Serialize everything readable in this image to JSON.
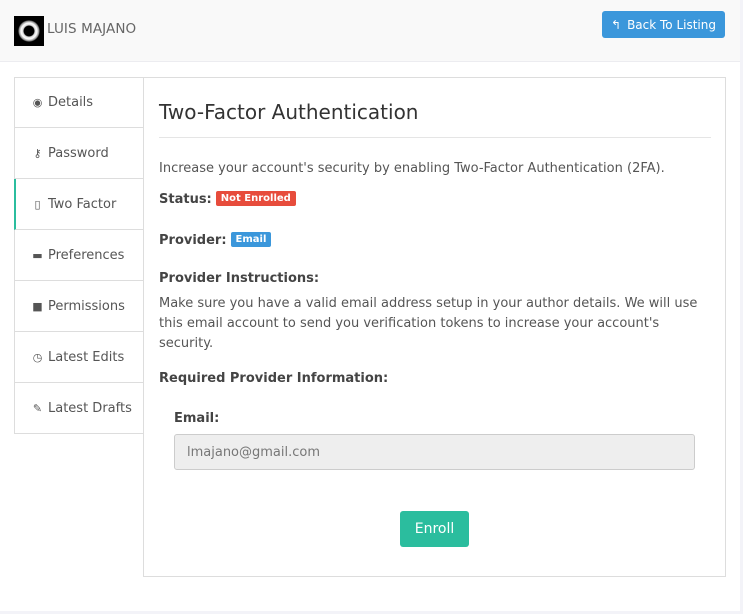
{
  "header": {
    "user_name": "LUIS MAJANO",
    "back_button": "Back To Listing"
  },
  "tabs": [
    {
      "label": "Details",
      "icon": "eye-icon",
      "glyph": "👁",
      "active": false
    },
    {
      "label": "Password",
      "icon": "key-icon",
      "glyph": "🔑",
      "active": false
    },
    {
      "label": "Two Factor",
      "icon": "mobile-icon",
      "glyph": "▯",
      "active": true
    },
    {
      "label": "Preferences",
      "icon": "briefcase-icon",
      "glyph": "💼",
      "active": false
    },
    {
      "label": "Permissions",
      "icon": "lock-icon",
      "glyph": "🔒",
      "active": false
    },
    {
      "label": "Latest Edits",
      "icon": "clock-icon",
      "glyph": "◷",
      "active": false
    },
    {
      "label": "Latest Drafts",
      "icon": "pencil-icon",
      "glyph": "✎",
      "active": false
    }
  ],
  "main": {
    "title": "Two-Factor Authentication",
    "intro": "Increase your account's security by enabling Two-Factor Authentication (2FA).",
    "status_label": "Status:",
    "status_value": "Not Enrolled",
    "provider_label": "Provider:",
    "provider_value": "Email",
    "instructions_label": "Provider Instructions:",
    "instructions_text": "Make sure you have a valid email address setup in your author details. We will use this email account to send you verification tokens to increase your account's security.",
    "required_label": "Required Provider Information:",
    "email_label": "Email:",
    "email_value": "lmajano@gmail.com",
    "enroll_button": "Enroll"
  },
  "colors": {
    "primary": "#3b97db",
    "danger": "#e74c3c",
    "success": "#2bbd9e"
  }
}
